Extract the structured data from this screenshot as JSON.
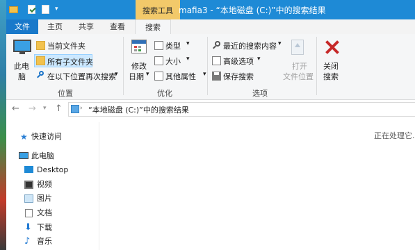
{
  "window": {
    "title": "mafia3 - “本地磁盘 (C:)”中的搜索结果",
    "context_tab": "搜索工具"
  },
  "tabs": [
    "文件",
    "主页",
    "共享",
    "查看",
    "搜索"
  ],
  "ribbon": {
    "location": {
      "this_pc": [
        "此电",
        "脑"
      ],
      "current_folder": "当前文件夹",
      "all_subfolders": "所有子文件夹",
      "search_again_in": "在以下位置再次搜索",
      "group": "位置"
    },
    "refine": {
      "date_modified": [
        "修改",
        "日期"
      ],
      "kind": "类型",
      "size": "大小",
      "other_props": "其他属性",
      "group": "优化"
    },
    "options": {
      "recent_searches": "最近的搜索内容",
      "advanced": "高级选项",
      "save_search": "保存搜索",
      "open_location": [
        "打开",
        "文件位置"
      ],
      "close_search": [
        "关闭",
        "搜索"
      ],
      "group": "选项"
    }
  },
  "address": {
    "text": "“本地磁盘 (C:)”中的搜索结果"
  },
  "nav": {
    "quick_access": "快速访问",
    "this_pc": "此电脑",
    "items": [
      "Desktop",
      "视频",
      "图片",
      "文档",
      "下载",
      "音乐"
    ]
  },
  "content": {
    "status": "正在处理它..."
  },
  "colors": {
    "titlebar": "#1e8ad6",
    "file_tab": "#1979ca",
    "context_tab": "#f2c96a"
  }
}
